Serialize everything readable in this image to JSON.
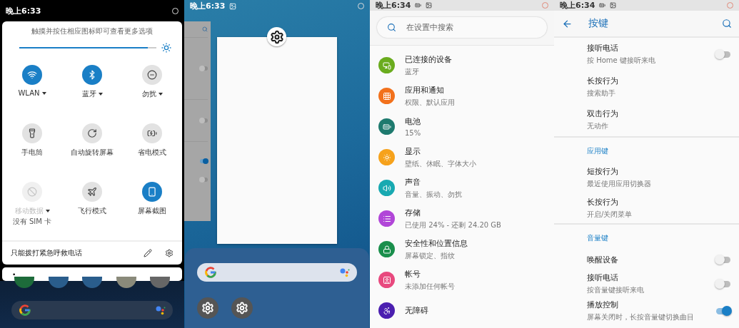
{
  "quick_settings": {
    "status_time": "晚上6:33",
    "hint": "触摸并按住相应图标即可查看更多选项",
    "brightness": {
      "level": 0.94,
      "auto": true
    },
    "tiles": [
      {
        "label": "WLAN",
        "on": true,
        "disabled": false,
        "dropdown": true
      },
      {
        "label": "蓝牙",
        "on": true,
        "disabled": false,
        "dropdown": true
      },
      {
        "label": "勿扰",
        "on": false,
        "disabled": false,
        "dropdown": true
      },
      {
        "label": "手电筒",
        "on": false,
        "disabled": false,
        "dropdown": false
      },
      {
        "label": "自动旋转屏幕",
        "on": false,
        "disabled": false,
        "dropdown": false
      },
      {
        "label": "省电模式",
        "on": false,
        "disabled": false,
        "dropdown": false
      },
      {
        "label": "移动数据",
        "sublabel": "没有 SIM 卡",
        "on": false,
        "disabled": true,
        "dropdown": true
      },
      {
        "label": "飞行模式",
        "on": false,
        "disabled": false,
        "dropdown": false
      },
      {
        "label": "屏幕截图",
        "on": true,
        "disabled": false,
        "dropdown": false
      }
    ],
    "footer_text": "只能拨打紧急呼救电话",
    "notification_text": "•"
  },
  "recents": {
    "status_time": "晚上6:33",
    "background_card": {
      "toggles": [
        {
          "on": false
        },
        {
          "on": false
        },
        {
          "on": true
        },
        {
          "on": false
        }
      ]
    }
  },
  "settings": {
    "status_time": "晚上6:34",
    "search": {
      "placeholder": "在设置中搜索"
    },
    "items": [
      {
        "title": "已连接的设备",
        "subtitle": "蓝牙",
        "color": "#6aac1e"
      },
      {
        "title": "应用和通知",
        "subtitle": "权限、默认应用",
        "color": "#f2711c"
      },
      {
        "title": "电池",
        "subtitle": "15%",
        "color": "#1e7a6e"
      },
      {
        "title": "显示",
        "subtitle": "壁纸、休眠、字体大小",
        "color": "#f6a21c"
      },
      {
        "title": "声音",
        "subtitle": "音量、振动、勿扰",
        "color": "#18a9b1"
      },
      {
        "title": "存储",
        "subtitle": "已使用 24% - 还剩 24.20 GB",
        "color": "#b146d8"
      },
      {
        "title": "安全性和位置信息",
        "subtitle": "屏幕锁定、指纹",
        "color": "#1a8f4c"
      },
      {
        "title": "帐号",
        "subtitle": "未添加任何帐号",
        "color": "#e8497e"
      },
      {
        "title": "无障碍",
        "color": "#4b1fb0"
      }
    ]
  },
  "buttons_settings": {
    "status_time": "晚上6:34",
    "title": "按键",
    "sections": [
      {
        "items": [
          {
            "kind": "toggle",
            "title": "接听电话",
            "subtitle": "按 Home 键接听来电",
            "on": false
          },
          {
            "kind": "plain",
            "title": "长按行为",
            "subtitle": "搜索助手"
          },
          {
            "kind": "plain",
            "title": "双击行为",
            "subtitle": "无动作"
          }
        ]
      },
      {
        "header": "应用键",
        "items": [
          {
            "kind": "plain",
            "title": "短按行为",
            "subtitle": "最近使用应用切换器"
          },
          {
            "kind": "plain",
            "title": "长按行为",
            "subtitle": "开启/关闭菜单"
          }
        ]
      },
      {
        "header": "音量键",
        "items": [
          {
            "kind": "toggle",
            "title": "唤醒设备",
            "on": false
          },
          {
            "kind": "toggle",
            "title": "接听电话",
            "subtitle": "按音量键接听来电",
            "on": false
          },
          {
            "kind": "toggle",
            "title": "播放控制",
            "subtitle": "屏幕关闭时，长按音量键切换曲目",
            "on": true
          }
        ]
      }
    ]
  }
}
